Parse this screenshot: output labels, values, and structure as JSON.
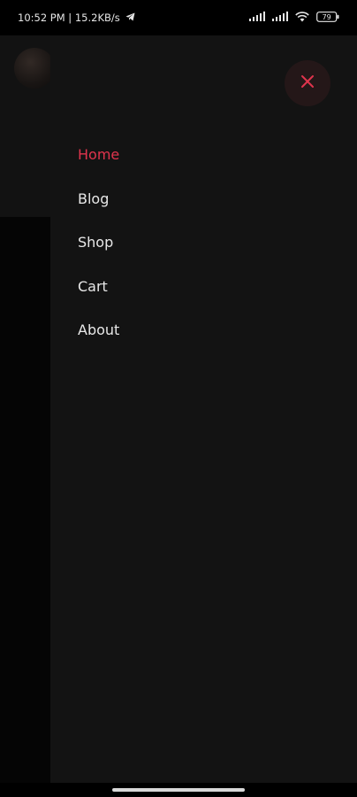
{
  "status_bar": {
    "time_speed": "10:52 PM | 15.2KB/s",
    "battery": "79",
    "icons": [
      "telegram-icon",
      "signal-icon",
      "signal-icon",
      "wifi-icon",
      "battery-icon"
    ]
  },
  "drawer": {
    "close_icon": "close-icon",
    "menu": [
      {
        "label": "Home",
        "active": true
      },
      {
        "label": "Blog",
        "active": false
      },
      {
        "label": "Shop",
        "active": false
      },
      {
        "label": "Cart",
        "active": false
      },
      {
        "label": "About",
        "active": false
      }
    ]
  },
  "colors": {
    "accent": "#e0344d",
    "drawer_bg": "#131313",
    "text": "#e8e8e8"
  }
}
